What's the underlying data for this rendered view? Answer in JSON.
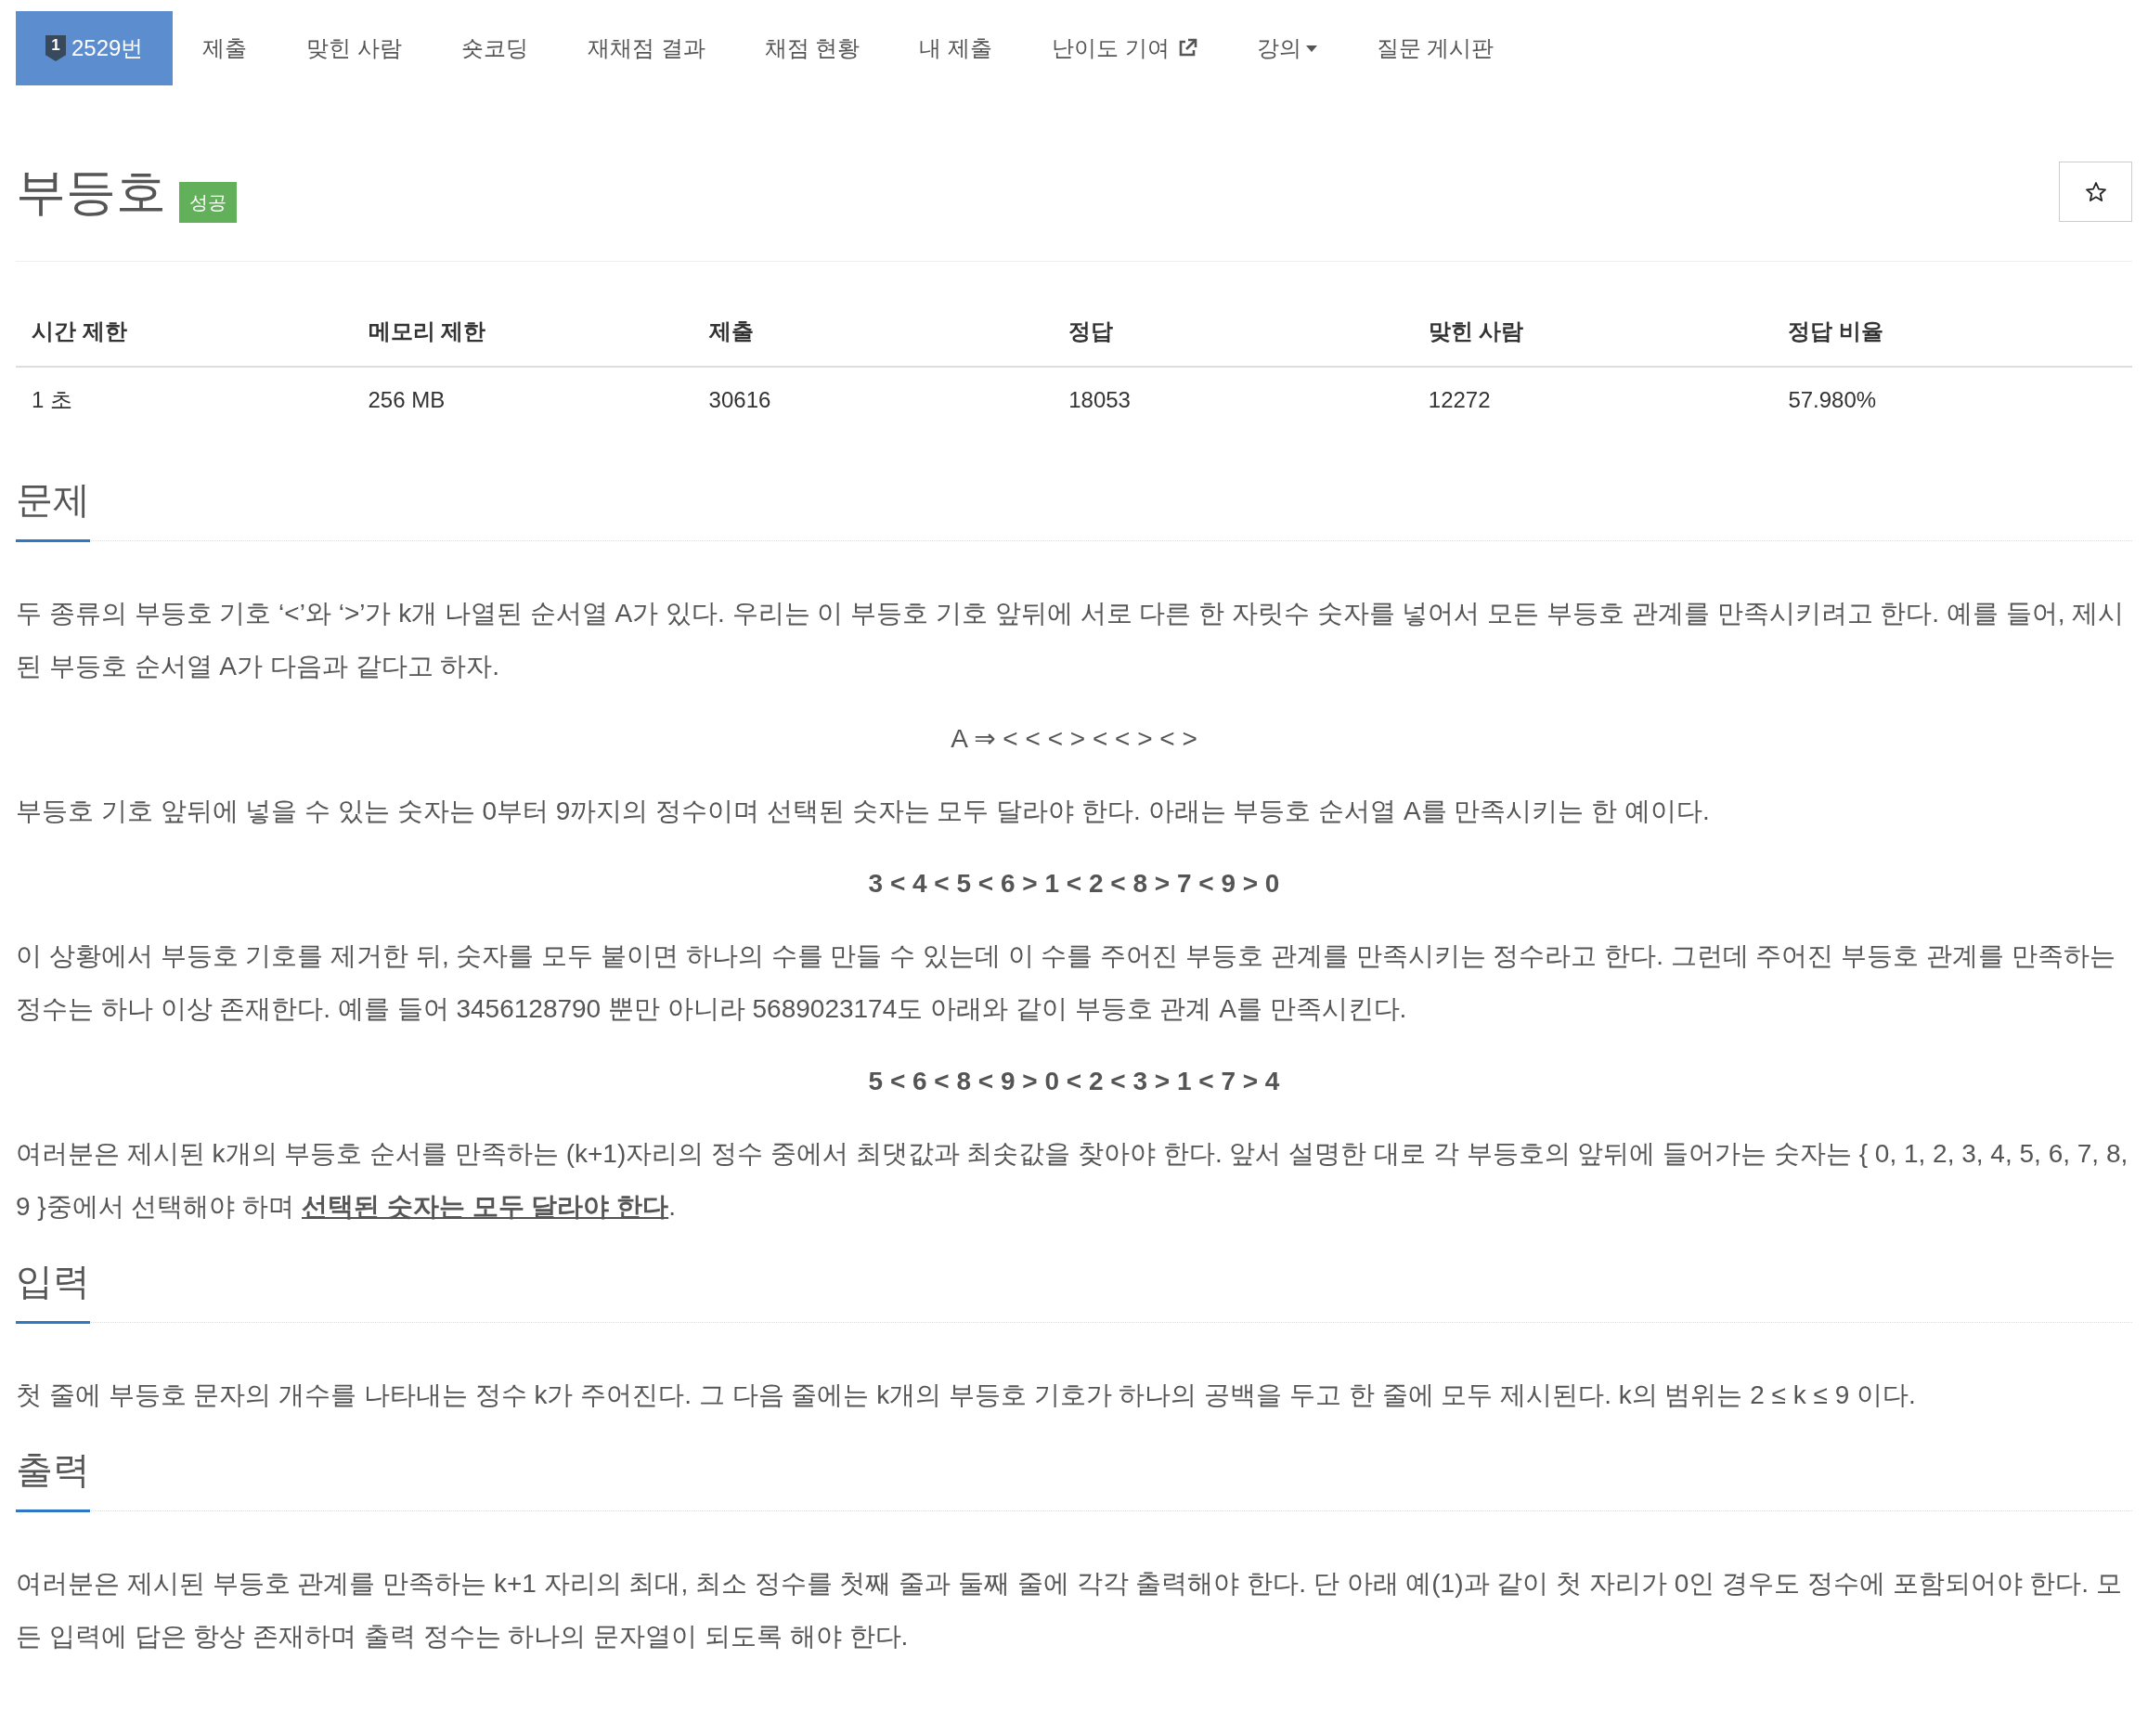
{
  "nav": {
    "tabs": [
      {
        "kind": "problem",
        "badge": "1",
        "label": "2529번",
        "selected": true
      },
      {
        "kind": "link",
        "label": "제출",
        "selected": false
      },
      {
        "kind": "link",
        "label": "맞힌 사람",
        "selected": false
      },
      {
        "kind": "link",
        "label": "숏코딩",
        "selected": false
      },
      {
        "kind": "link",
        "label": "재채점 결과",
        "selected": false
      },
      {
        "kind": "link",
        "label": "채점 현황",
        "selected": false
      },
      {
        "kind": "link",
        "label": "내 제출",
        "selected": false
      },
      {
        "kind": "external",
        "label": "난이도 기여",
        "selected": false
      },
      {
        "kind": "dropdown",
        "label": "강의",
        "selected": false
      },
      {
        "kind": "link",
        "label": "질문 게시판",
        "selected": false
      }
    ]
  },
  "problem": {
    "title": "부등호",
    "result_badge": "성공"
  },
  "info_table": {
    "columns": [
      "시간 제한",
      "메모리 제한",
      "제출",
      "정답",
      "맞힌 사람",
      "정답 비율"
    ],
    "rows": [
      [
        "1 초",
        "256 MB",
        "30616",
        "18053",
        "12272",
        "57.980%"
      ]
    ]
  },
  "sections": [
    {
      "heading": "문제",
      "blocks": [
        {
          "kind": "paragraph",
          "text": "두 종류의 부등호 기호 ‘<’와 ‘>’가 k개 나열된 순서열 A가 있다. 우리는 이 부등호 기호 앞뒤에 서로 다른 한 자릿수 숫자를 넣어서 모든 부등호 관계를 만족시키려고 한다. 예를 들어, 제시된 부등호 순서열 A가 다음과 같다고 하자."
        },
        {
          "kind": "display",
          "text": "A ⇒ < < < > < < > < >"
        },
        {
          "kind": "paragraph",
          "text": "부등호 기호 앞뒤에 넣을 수 있는 숫자는 0부터 9까지의 정수이며 선택된 숫자는 모두 달라야 한다. 아래는 부등호 순서열 A를 만족시키는 한 예이다."
        },
        {
          "kind": "display_bold",
          "text": "3 < 4 < 5 < 6 > 1 < 2 < 8 > 7 < 9 > 0"
        },
        {
          "kind": "paragraph",
          "text": "이 상황에서 부등호 기호를 제거한 뒤, 숫자를 모두 붙이면 하나의 수를 만들 수 있는데 이 수를 주어진 부등호 관계를 만족시키는 정수라고 한다. 그런데 주어진 부등호 관계를 만족하는 정수는 하나 이상 존재한다. 예를 들어 3456128790 뿐만 아니라 5689023174도 아래와 같이 부등호 관계 A를 만족시킨다."
        },
        {
          "kind": "display_bold",
          "text": "5 < 6 < 8 < 9 > 0 < 2 < 3 > 1 < 7 > 4"
        },
        {
          "kind": "paragraph",
          "text": "여러분은 제시된 k개의 부등호 순서를 만족하는 (k+1)자리의 정수 중에서 최댓값과 최솟값을 찾아야 한다. 앞서 설명한 대로 각 부등호의 앞뒤에 들어가는 숫자는 { 0, 1, 2, 3, 4, 5, 6, 7, 8, 9 }중에서 선택해야 하며 **선택된 숫자는 모두 달라야 한다**."
        }
      ]
    },
    {
      "heading": "입력",
      "blocks": [
        {
          "kind": "paragraph",
          "text": "첫 줄에 부등호 문자의 개수를 나타내는 정수 k가 주어진다. 그 다음 줄에는 k개의 부등호 기호가 하나의 공백을 두고 한 줄에 모두 제시된다. k의 범위는 2 ≤ k ≤ 9 이다."
        }
      ]
    },
    {
      "heading": "출력",
      "blocks": [
        {
          "kind": "paragraph",
          "text": "여러분은 제시된 부등호 관계를 만족하는 k+1 자리의 최대, 최소 정수를 첫째 줄과 둘째 줄에 각각 출력해야 한다. 단 아래 예(1)과 같이 첫 자리가 0인 경우도 정수에 포함되어야 한다. 모든 입력에 답은 항상 존재하며 출력 정수는 하나의 문자열이 되도록 해야 한다."
        }
      ]
    }
  ]
}
